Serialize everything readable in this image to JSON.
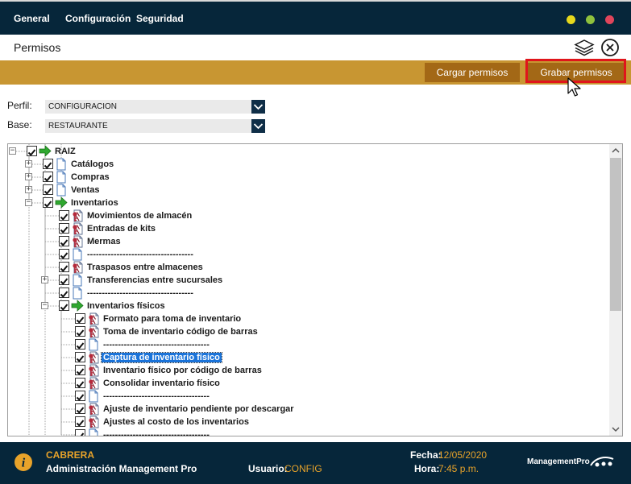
{
  "menu": [
    "General",
    "Configuración",
    "Seguridad"
  ],
  "window_dots": [
    "#e6d81c",
    "#8fc13d",
    "#e0455b"
  ],
  "page_title": "Permisos",
  "actions": {
    "load_label": "Cargar permisos",
    "save_label": "Grabar permisos"
  },
  "form": {
    "perfil_label": "Perfil:",
    "perfil_value": "CONFIGURACION",
    "base_label": "Base:",
    "base_value": "RESTAURANTE"
  },
  "tree": [
    {
      "label": "RAIZ",
      "level": 0,
      "icon": "arrow",
      "expander": "-",
      "checked": true
    },
    {
      "label": "Catálogos",
      "level": 1,
      "icon": "doc",
      "expander": "+",
      "checked": true
    },
    {
      "label": "Compras",
      "level": 1,
      "icon": "doc",
      "expander": "+",
      "checked": true
    },
    {
      "label": "Ventas",
      "level": 1,
      "icon": "doc",
      "expander": "+",
      "checked": true
    },
    {
      "label": "Inventarios",
      "level": 1,
      "icon": "arrow",
      "expander": "-",
      "checked": true
    },
    {
      "label": "Movimientos de almacén",
      "level": 2,
      "icon": "key",
      "expander": "",
      "checked": true
    },
    {
      "label": "Entradas de kits",
      "level": 2,
      "icon": "key",
      "expander": "",
      "checked": true
    },
    {
      "label": "Mermas",
      "level": 2,
      "icon": "key",
      "expander": "",
      "checked": true
    },
    {
      "label": "------------------------------------",
      "level": 2,
      "icon": "doc",
      "expander": "",
      "checked": true
    },
    {
      "label": "Traspasos entre almacenes",
      "level": 2,
      "icon": "key",
      "expander": "",
      "checked": true
    },
    {
      "label": "Transferencias entre sucursales",
      "level": 2,
      "icon": "doc",
      "expander": "+",
      "checked": true
    },
    {
      "label": "------------------------------------",
      "level": 2,
      "icon": "doc",
      "expander": "",
      "checked": true
    },
    {
      "label": "Inventarios físicos",
      "level": 2,
      "icon": "arrow",
      "expander": "-",
      "checked": true
    },
    {
      "label": "Formato para toma de inventario",
      "level": 3,
      "icon": "key",
      "expander": "",
      "checked": true
    },
    {
      "label": "Toma de inventario código de barras",
      "level": 3,
      "icon": "key",
      "expander": "",
      "checked": true
    },
    {
      "label": "------------------------------------",
      "level": 3,
      "icon": "doc",
      "expander": "",
      "checked": true
    },
    {
      "label": "Captura de inventario físico",
      "level": 3,
      "icon": "key",
      "expander": "",
      "checked": true,
      "selected": true
    },
    {
      "label": "Inventario físico por código de barras",
      "level": 3,
      "icon": "key",
      "expander": "",
      "checked": true
    },
    {
      "label": "Consolidar inventario físico",
      "level": 3,
      "icon": "key",
      "expander": "",
      "checked": true
    },
    {
      "label": "------------------------------------",
      "level": 3,
      "icon": "doc",
      "expander": "",
      "checked": true
    },
    {
      "label": "Ajuste de inventario pendiente por descargar",
      "level": 3,
      "icon": "key",
      "expander": "",
      "checked": true
    },
    {
      "label": "Ajustes al costo de los inventarios",
      "level": 3,
      "icon": "key",
      "expander": "",
      "checked": true
    },
    {
      "label": "------------------------------------",
      "level": 3,
      "icon": "doc",
      "expander": "",
      "checked": true
    }
  ],
  "status": {
    "user_name": "CABRERA",
    "company": "Administración Management Pro",
    "usuario_label": "Usuario:",
    "usuario_value": "CONFIG",
    "fecha_label": "Fecha:",
    "fecha_value": "12/05/2020",
    "hora_label": "Hora:",
    "hora_value": "7:45 p.m.",
    "brand": "ManagementPro"
  },
  "colors": {
    "navy": "#06263a",
    "gold": "#c89632",
    "button_brown": "#a36816",
    "accent_text": "#e8a32a",
    "highlight_red": "#e0151b"
  }
}
